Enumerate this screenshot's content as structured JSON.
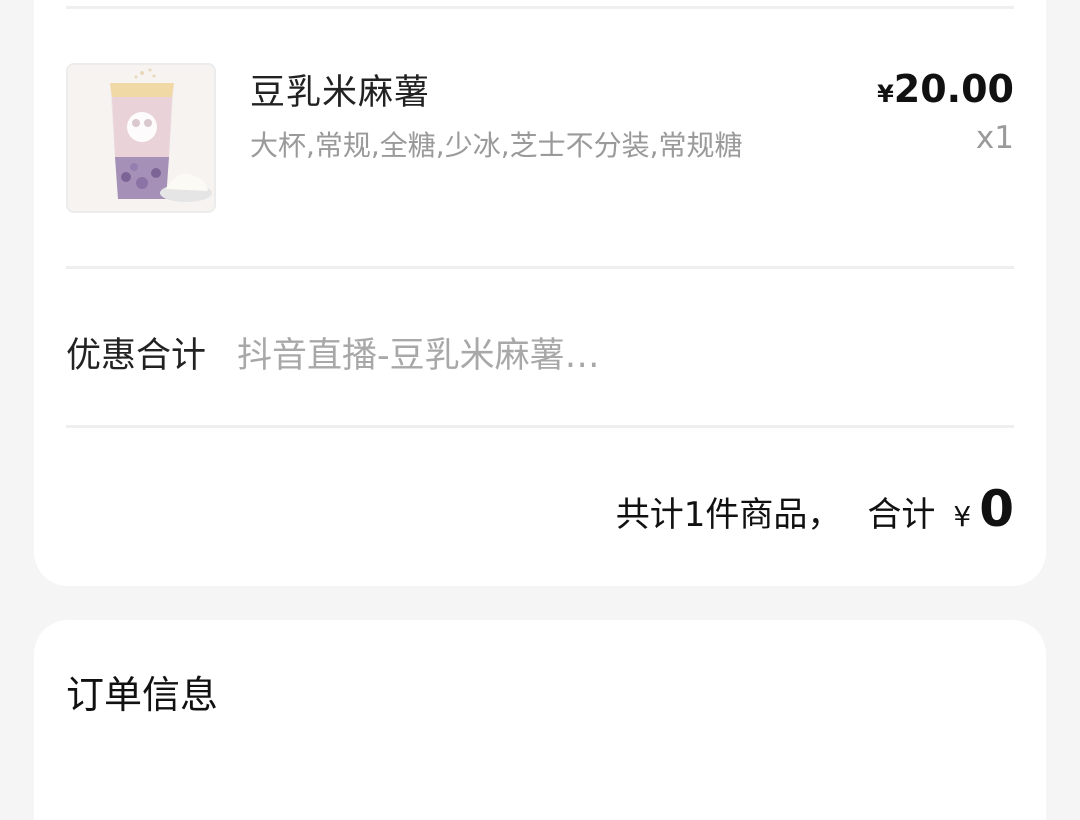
{
  "order_item": {
    "name": "豆乳米麻薯",
    "spec": "大杯,常规,全糖,少冰,芝士不分装,常规糖",
    "price_currency": "¥",
    "price": "20.00",
    "quantity": "x1",
    "image_icon": "milk-tea-cup-image"
  },
  "discount": {
    "label": "优惠合计",
    "value": "抖音直播-豆乳米麻薯…"
  },
  "summary": {
    "count_text": "共计1件商品，",
    "total_label": "合计",
    "currency": "¥",
    "total": "0"
  },
  "order_info": {
    "title": "订单信息"
  },
  "colors": {
    "background": "#f5f5f5",
    "card": "#ffffff",
    "primary_text": "#222222",
    "secondary_text": "#9a9a9a",
    "divider": "#efefef"
  }
}
